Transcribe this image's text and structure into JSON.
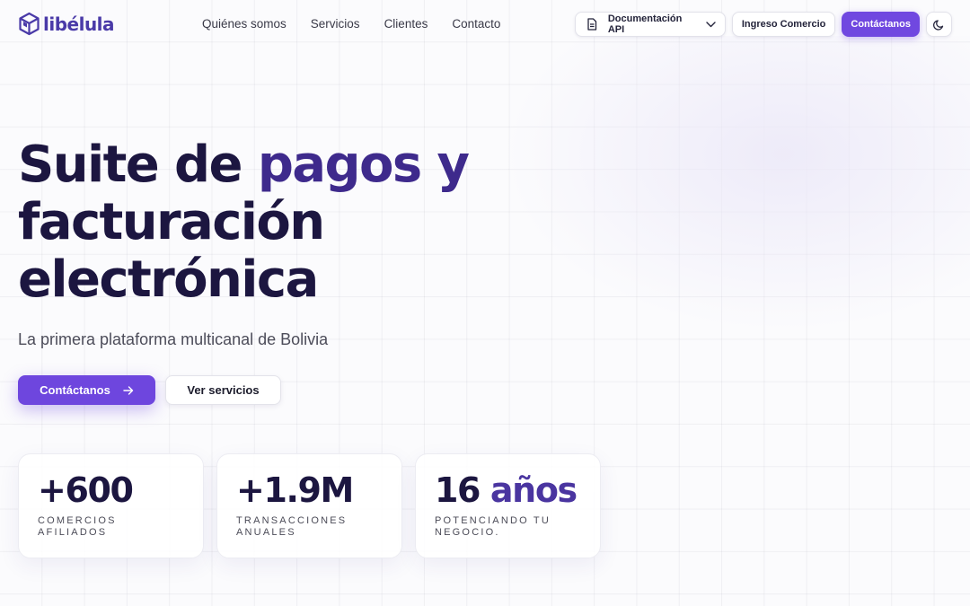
{
  "header": {
    "logo_text": "libélula",
    "nav": [
      {
        "label": "Quiénes somos"
      },
      {
        "label": "Servicios"
      },
      {
        "label": "Clientes"
      },
      {
        "label": "Contacto"
      }
    ],
    "docs_label": "Documentación API",
    "login_label": "Ingreso Comercio",
    "contact_label": "Contáctanos",
    "icons": {
      "docs": "document-icon",
      "dropdown": "chevron-down-icon",
      "theme": "moon-icon"
    }
  },
  "hero": {
    "title_line1_a": "Suite de ",
    "title_line1_b": "pagos y",
    "title_line2": "facturación",
    "title_line3": "electrónica",
    "subtitle": "La primera plataforma multicanal de Bolivia",
    "primary_cta": "Contáctanos",
    "secondary_cta": "Ver servicios"
  },
  "stats": [
    {
      "value": "+600",
      "value_accent": "",
      "label_line1": "COMERCIOS AFILIADOS",
      "label_line2": ""
    },
    {
      "value": "+1.9M",
      "value_accent": "",
      "label_line1": "TRANSACCIONES",
      "label_line2": "ANUALES"
    },
    {
      "value": "16 ",
      "value_accent": "años",
      "label_line1": "POTENCIANDO TU",
      "label_line2": "NEGOCIO."
    }
  ],
  "colors": {
    "brand": "#6e46de",
    "title": "#1c1640",
    "accent": "#3e2a8c"
  }
}
